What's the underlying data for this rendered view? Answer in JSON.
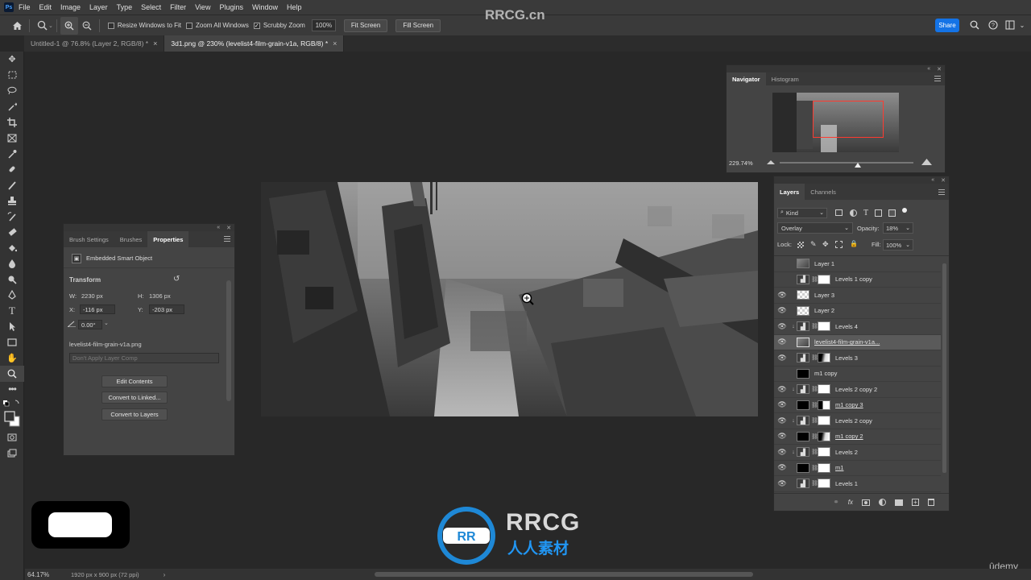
{
  "menubar": {
    "app_icon": "Ps",
    "items": [
      "File",
      "Edit",
      "Image",
      "Layer",
      "Type",
      "Select",
      "Filter",
      "View",
      "Plugins",
      "Window",
      "Help"
    ]
  },
  "options": {
    "resize_windows": "Resize Windows to Fit",
    "zoom_all": "Zoom All Windows",
    "scrubby": "Scrubby Zoom",
    "zoom_value": "100%",
    "fit_screen": "Fit Screen",
    "fill_screen": "Fill Screen",
    "share": "Share"
  },
  "tabs": [
    {
      "label": "Untitled-1 @ 76.8% (Layer 2, RGB/8) *",
      "close": "×"
    },
    {
      "label": "3d1.png @ 230% (levelist4-film-grain-v1a, RGB/8) *",
      "close": "×"
    }
  ],
  "navigator": {
    "tabs": [
      "Navigator",
      "Histogram"
    ],
    "zoom": "229.74%"
  },
  "properties": {
    "tabs": [
      "Brush Settings",
      "Brushes",
      "Properties"
    ],
    "type": "Embedded Smart Object",
    "section": "Transform",
    "w_label": "W:",
    "w_value": "2230 px",
    "h_label": "H:",
    "h_value": "1306 px",
    "x_label": "X:",
    "x_value": "-116 px",
    "y_label": "Y:",
    "y_value": "-203 px",
    "angle": "0.00°",
    "filename": "levelist4-film-grain-v1a.png",
    "layer_comp": "Don't Apply Layer Comp",
    "btn_edit": "Edit Contents",
    "btn_linked": "Convert to Linked...",
    "btn_layers": "Convert to Layers"
  },
  "layers": {
    "tabs": [
      "Layers",
      "Channels"
    ],
    "filter": "Kind",
    "blend_mode": "Overlay",
    "opacity_label": "Opacity:",
    "opacity": "18%",
    "lock_label": "Lock:",
    "fill_label": "Fill:",
    "fill": "100%",
    "rows": [
      {
        "name": "Layer 1",
        "eye": "",
        "clip": "",
        "thumbs": [
          "photo"
        ],
        "chain": false,
        "mask": "",
        "underline": false,
        "selected": false
      },
      {
        "name": "Levels 1 copy",
        "eye": "",
        "clip": "",
        "thumbs": [
          "adj"
        ],
        "chain": true,
        "mask": "white",
        "underline": false,
        "selected": false
      },
      {
        "name": "Layer 3",
        "eye": "👁",
        "clip": "",
        "thumbs": [
          "checker"
        ],
        "chain": false,
        "mask": "",
        "underline": false,
        "selected": false
      },
      {
        "name": "Layer 2",
        "eye": "👁",
        "clip": "",
        "thumbs": [
          "checker"
        ],
        "chain": false,
        "mask": "",
        "underline": false,
        "selected": false
      },
      {
        "name": "Levels 4",
        "eye": "👁",
        "clip": "↓",
        "thumbs": [
          "adj"
        ],
        "chain": true,
        "mask": "white",
        "underline": false,
        "selected": false
      },
      {
        "name": "levelist4-film-grain-v1a...",
        "eye": "👁",
        "clip": "",
        "thumbs": [
          "photo"
        ],
        "chain": false,
        "mask": "",
        "underline": true,
        "selected": true
      },
      {
        "name": "Levels 3",
        "eye": "👁",
        "clip": "",
        "thumbs": [
          "adj"
        ],
        "chain": true,
        "mask": "mixed2",
        "underline": false,
        "selected": false
      },
      {
        "name": "m1 copy",
        "eye": "",
        "clip": "",
        "thumbs": [
          "black"
        ],
        "chain": false,
        "mask": "",
        "underline": false,
        "selected": false
      },
      {
        "name": "Levels 2 copy 2",
        "eye": "👁",
        "clip": "↓",
        "thumbs": [
          "adj"
        ],
        "chain": true,
        "mask": "white",
        "underline": false,
        "selected": false
      },
      {
        "name": "m1 copy 3",
        "eye": "👁",
        "clip": "",
        "thumbs": [
          "black"
        ],
        "chain": true,
        "mask": "mixed",
        "underline": true,
        "selected": false
      },
      {
        "name": "Levels 2 copy",
        "eye": "👁",
        "clip": "↓",
        "thumbs": [
          "adj"
        ],
        "chain": true,
        "mask": "white",
        "underline": false,
        "selected": false
      },
      {
        "name": "m1 copy 2",
        "eye": "👁",
        "clip": "",
        "thumbs": [
          "black"
        ],
        "chain": true,
        "mask": "mixed2",
        "underline": true,
        "selected": false
      },
      {
        "name": "Levels 2",
        "eye": "👁",
        "clip": "↓",
        "thumbs": [
          "adj"
        ],
        "chain": true,
        "mask": "white",
        "underline": false,
        "selected": false
      },
      {
        "name": "m1",
        "eye": "👁",
        "clip": "",
        "thumbs": [
          "black"
        ],
        "chain": true,
        "mask": "white",
        "underline": true,
        "selected": false
      },
      {
        "name": "Levels 1",
        "eye": "👁",
        "clip": "",
        "thumbs": [
          "adj"
        ],
        "chain": true,
        "mask": "white",
        "underline": false,
        "selected": false
      }
    ],
    "footer_icons": [
      "link-icon",
      "fx-icon",
      "mask-icon",
      "adjustment-icon",
      "folder-icon",
      "new-layer-icon",
      "trash-icon"
    ]
  },
  "status": {
    "zoom": "64.17%",
    "doc_info": "1920 px x 900 px (72 ppi)",
    "arrow": "›"
  },
  "watermark": {
    "brand": "RRCG.cn",
    "logo_title": "RRCG",
    "logo_sub": "人人素材",
    "udemy": "ûdemy"
  }
}
